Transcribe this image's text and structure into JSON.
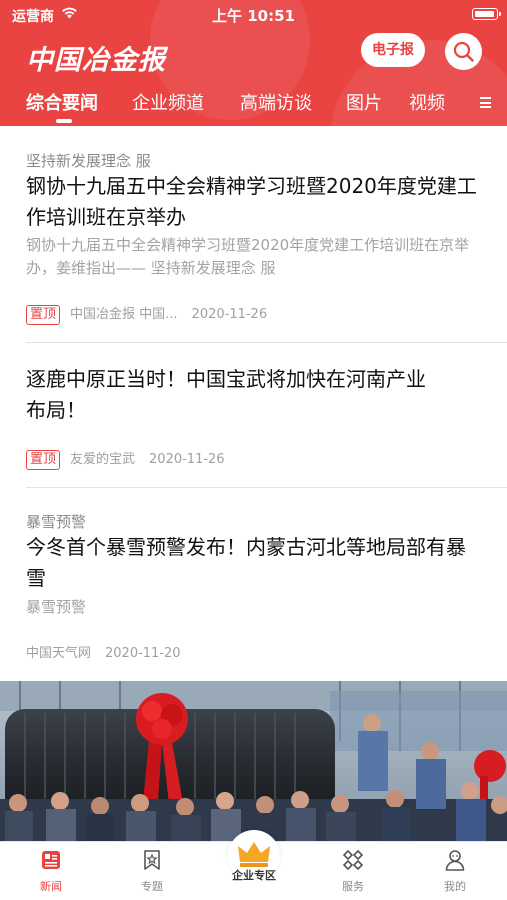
{
  "status_bar": {
    "carrier": "运营商",
    "time": "上午 10:51"
  },
  "header": {
    "logo_text": "中国冶金报",
    "epaper_label": "电子报",
    "brand_color": "#e94342"
  },
  "channel_tabs": [
    {
      "label": "综合要闻",
      "active": true
    },
    {
      "label": "企业频道",
      "active": false
    },
    {
      "label": "高端访谈",
      "active": false
    },
    {
      "label": "图片",
      "active": false
    },
    {
      "label": "视频",
      "active": false
    }
  ],
  "articles": [
    {
      "kicker": "坚持新发展理念 服",
      "title": "钢协十九届五中全会精神学习班暨2020年度党建工作培训班在京举办",
      "summary": "钢协十九届五中全会精神学习班暨2020年度党建工作培训班在京举办，姜维指出—— 坚持新发展理念 服",
      "badge": "置顶",
      "source": "中国冶金报 中国...",
      "date": "2020-11-26"
    },
    {
      "title": "逐鹿中原正当时！中国宝武将加快在河南产业布局！",
      "badge": "置顶",
      "source": "友爱的宝武",
      "date": "2020-11-26"
    },
    {
      "kicker": "暴雪预警",
      "title": "今冬首个暴雪预警发布！内蒙古河北等地局部有暴雪",
      "summary": "暴雪预警",
      "source": "中国天气网",
      "date": "2020-11-20"
    }
  ],
  "bottom_nav": [
    {
      "label": "新闻",
      "icon": "news-icon",
      "active": true
    },
    {
      "label": "专题",
      "icon": "topic-icon",
      "active": false
    },
    {
      "label": "企业专区",
      "icon": "crown-icon",
      "active": false
    },
    {
      "label": "服务",
      "icon": "service-grid-icon",
      "active": false
    },
    {
      "label": "我的",
      "icon": "profile-icon",
      "active": false
    }
  ]
}
